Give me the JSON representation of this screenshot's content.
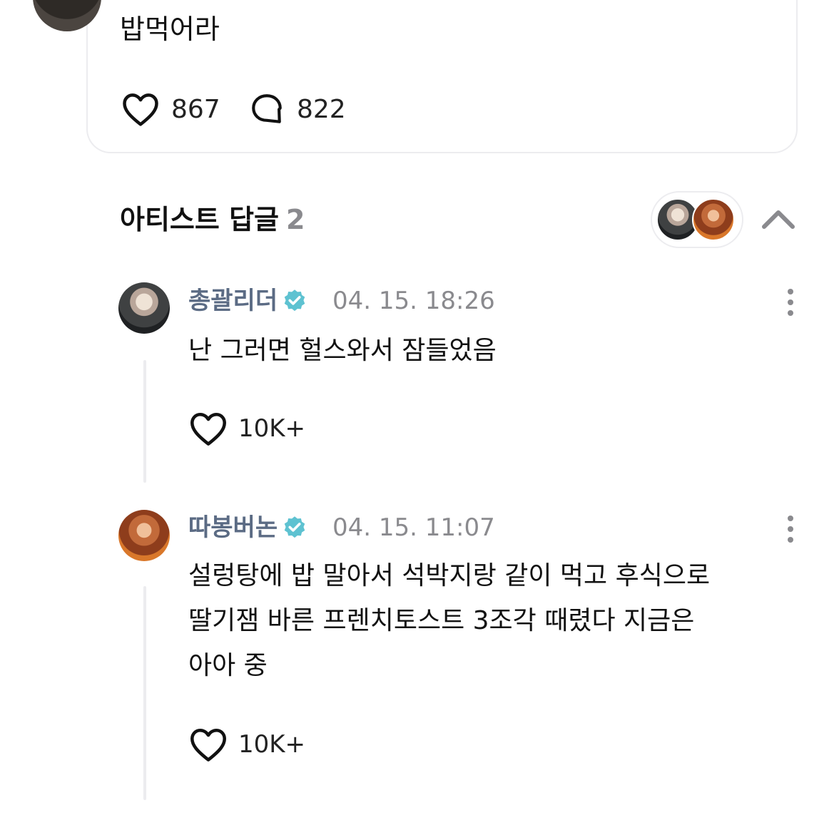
{
  "post": {
    "text": "밥먹어라",
    "likes": "867",
    "comments": "822"
  },
  "artist_replies": {
    "title": "아티스트 답글",
    "count": "2"
  },
  "replies": [
    {
      "name": "총괄리더",
      "time": "04. 15. 18:26",
      "lines": [
        "난 그러면 헐스와서 잠들었음"
      ],
      "likes": "10K+"
    },
    {
      "name": "따봉버논",
      "time": "04. 15. 11:07",
      "lines": [
        "설렁탕에 밥 말아서 석박지랑 같이 먹고 후식으로",
        "딸기잼 바른 프렌치토스트 3조각 때렸다 지금은",
        "아아 중"
      ],
      "likes": "10K+"
    }
  ],
  "colors": {
    "verified": "#5ec2d1",
    "name": "#5b6b84",
    "muted": "#8a8a8e",
    "border": "#ececef"
  },
  "icons": [
    "heart-icon",
    "comment-bubble-icon",
    "verified-badge-icon",
    "chevron-up-icon",
    "more-vertical-icon"
  ]
}
